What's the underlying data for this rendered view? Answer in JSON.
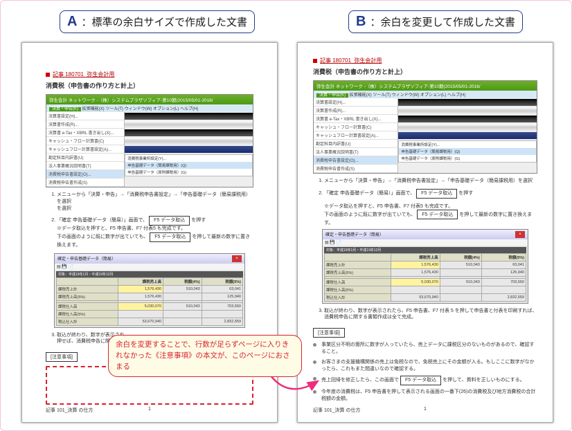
{
  "labelA": {
    "letter": "A",
    "text": "：標準の余白サイズで作成した文書"
  },
  "labelB": {
    "letter": "B",
    "text": "：余白を変更して作成した文書"
  },
  "pageA": {
    "linkText": "記事 180701_弥生会計用",
    "title": "消費税（申告書の作り方と計上）",
    "win1": {
      "title": "弥生会計 ネットワーク -（株）システムプラザソフィア-第10期(2015/05/01-2016/",
      "greenTab": "決算・申告(K)",
      "menus": [
        "拡張機能(X)",
        "ツール(T)",
        "ウィンドウ(W)",
        "オプション(L)",
        "ヘルプ(H)"
      ],
      "sideItems": [
        "決算書設定(H)...",
        "決算書作成(R)...",
        "決算書 e-Tax・XBRL 書き出し(X)...",
        "キャッシュ・フロー計算書(C)",
        "キャッシュフロー計算書設定(A)...",
        "勘定科目内訳書(U)",
        "法人事業概況説明書(T)",
        "消費税申告書設定(O)...",
        "消費税申告書作成(S)"
      ],
      "rightItems": [
        "消費税事業所設定(Y)...",
        "申告基礎データ（簡易課税用）(Q)",
        "申告基礎データ（原則課税用）(G)"
      ]
    },
    "steps": [
      {
        "text_a": "メニューから「決算・申告」→「消費税申告書設定」→「申告基礎データ（簡易課税用）を選択",
        "text_b": "を選択"
      },
      {
        "text_a": "「確定 申告基礎データ（簡易）」画面で、",
        "btn": "F5 データ取込",
        "text_b": "を押す",
        "note_a": "※データ取込を押すと、F5 申告書、F7 付表5 も完成です。",
        "note_b": "下の画面のように既に数字が出ていても、",
        "note_btn": "F5 データ取込",
        "note_c": "を押して最新の数字に置き換えます。"
      }
    ],
    "win2": {
      "title": "確定・申告基礎データ（簡易）",
      "range": "対象：平成19年1月・平成19年12月",
      "headers": [
        "",
        "課税売上高",
        "税額(4%)",
        "税額(5%)"
      ],
      "rows": [
        [
          "課税売上計",
          "1,576,430",
          "510,043",
          "63,041"
        ],
        [
          "課税売上高(5%)",
          "1,576,430",
          "",
          "125,940"
        ],
        [
          "",
          "",
          "",
          ""
        ],
        [
          "課税仕入高",
          "5,030,070",
          "510,043",
          "703,550"
        ],
        [
          "課税仕入高(5%)",
          "",
          "",
          ""
        ],
        [
          "税込仕入計",
          "53,670,940",
          "",
          "2,832,559"
        ]
      ]
    },
    "step3": {
      "text_a": "取込が終わり、数字が表示され",
      "text_b": "押せば、消費税申告に関する書類作成は全て完成。"
    },
    "noticeHead": "[注意事項]",
    "footerLeft": "記事 101_決算 の仕方",
    "pageNum": "1"
  },
  "pageB": {
    "linkText": "記事 180701_弥生会計用",
    "title": "消費税（申告書の作り方と計上）",
    "win1": {
      "title": "弥生会計 ネットワーク -（株）システムプラザソフィア-第10期(2015/05/01-2016/",
      "greenTab": "決算・申告(K)",
      "menus": [
        "拡張機能(X)",
        "ツール(T)",
        "ウィンドウ(W)",
        "オプション(L)",
        "ヘルプ(H)"
      ],
      "sideItems": [
        "決算書設定(H)...",
        "決算書作成(R)...",
        "決算書 e-Tax・XBRL 書き出し(X)...",
        "キャッシュ・フロー計算書(C)",
        "キャッシュフロー計算書設定(A)...",
        "勘定科目内訳書(U)",
        "法人事業概況説明書(T)",
        "消費税申告書設定(O)...",
        "消費税申告書作成(S)"
      ],
      "rightItems": [
        "消費税事業所設定(Y)...",
        "申告基礎データ（簡易課税用）(Q)",
        "申告基礎データ（原則課税用）(G)"
      ]
    },
    "step1": "メニューから「決算・申告」→「消費税申告書設定」→「申告基礎データ（簡易課税用）を選択",
    "step2": {
      "a": "「確定 申告基礎データ（簡易）」画面で、",
      "btn": "F5 データ取込",
      "b": "を押す"
    },
    "note_a": "※データ取込を押すと、F5 申告書、F7 付表5 も完成です。",
    "note_b": "下の画面のように既に数字が出ていても、",
    "note_btn": "F5 データ取込",
    "note_c": "を押して最新の数字に置き換えます。",
    "win2": {
      "title": "確定・申告基礎データ（簡易）",
      "range": "対象：平成19年1月・平成19年12月",
      "headers": [
        "",
        "課税売上高",
        "税額(4%)",
        "税額(5%)"
      ],
      "rows": [
        [
          "課税売上計",
          "1,576,430",
          "510,043",
          "63,041"
        ],
        [
          "課税売上高(5%)",
          "1,576,430",
          "",
          "125,940"
        ],
        [
          "",
          "",
          "",
          ""
        ],
        [
          "課税仕入高",
          "5,030,070",
          "510,043",
          "703,550"
        ],
        [
          "課税仕入高(5%)",
          "",
          "",
          ""
        ],
        [
          "税込仕入計",
          "53,670,940",
          "",
          "2,832,559"
        ]
      ]
    },
    "step3": "取込が終わり、数字が表示されたら、F5 申告書、F7 付表 5 を押して申告書と付表を印刷すれば、消費税申告に関する書類作成は全て完成。",
    "noticeHead": "[注意事項]",
    "bullets": [
      {
        "a": "事業区分不明の箇所に数字が入っていたら、売上データに課税区分のないものがあるので、確認すること。"
      },
      {
        "a": "お客さまの支援機構関係の売上は免税なので、免税売上にその金額が入る。もしここに数字がなかったら、これもまた間違いなので確認する。"
      },
      {
        "a": "売上回帰を修正したら、この画面で",
        "btn": "F5 データ取込",
        "b": "を押して、資料を正しいものにする。"
      },
      {
        "a": "今年度の消費税は、F5 申告書を押して表示される画面の一番下(26)の消費税及び地方消費税の合計税額の金額。"
      }
    ],
    "footerLeft": "記事 101_決算 の仕方",
    "pageNum": "1"
  },
  "callout": "余白を変更することで、行数が足らずページに入りきれなかった《注意事項》の本文が、このページにおさまる"
}
